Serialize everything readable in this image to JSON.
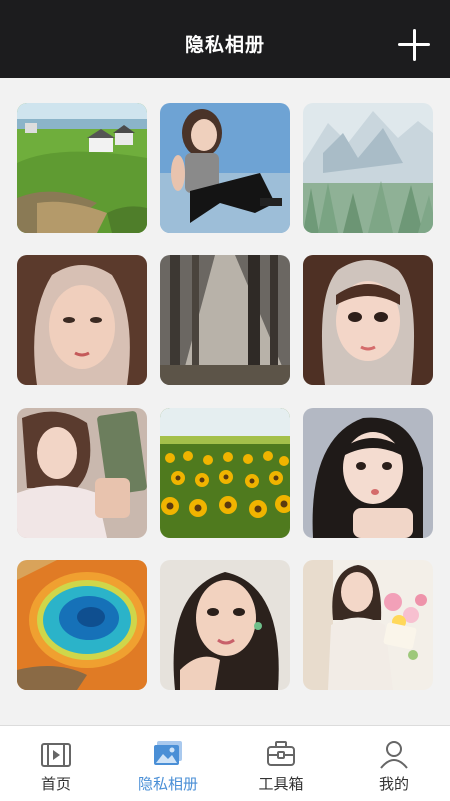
{
  "header": {
    "title": "隐私相册"
  },
  "photos": [
    {
      "name": "photo-coastal-village"
    },
    {
      "name": "photo-girl-sitting"
    },
    {
      "name": "photo-snow-mountains"
    },
    {
      "name": "photo-girl-portrait-1"
    },
    {
      "name": "photo-forest-sunrays"
    },
    {
      "name": "photo-girl-portrait-2"
    },
    {
      "name": "photo-girl-reading"
    },
    {
      "name": "photo-sunflower-field"
    },
    {
      "name": "photo-girl-pout"
    },
    {
      "name": "photo-hot-spring"
    },
    {
      "name": "photo-girl-hand-chin"
    },
    {
      "name": "photo-girl-flowers"
    }
  ],
  "tabs": [
    {
      "label": "首页",
      "icon": "film-icon",
      "active": false
    },
    {
      "label": "隐私相册",
      "icon": "image-icon",
      "active": true
    },
    {
      "label": "工具箱",
      "icon": "toolbox-icon",
      "active": false
    },
    {
      "label": "我的",
      "icon": "user-icon",
      "active": false
    }
  ],
  "colors": {
    "header_bg": "#1c1c1e",
    "accent": "#4a8fd6",
    "tab_text": "#333333"
  }
}
